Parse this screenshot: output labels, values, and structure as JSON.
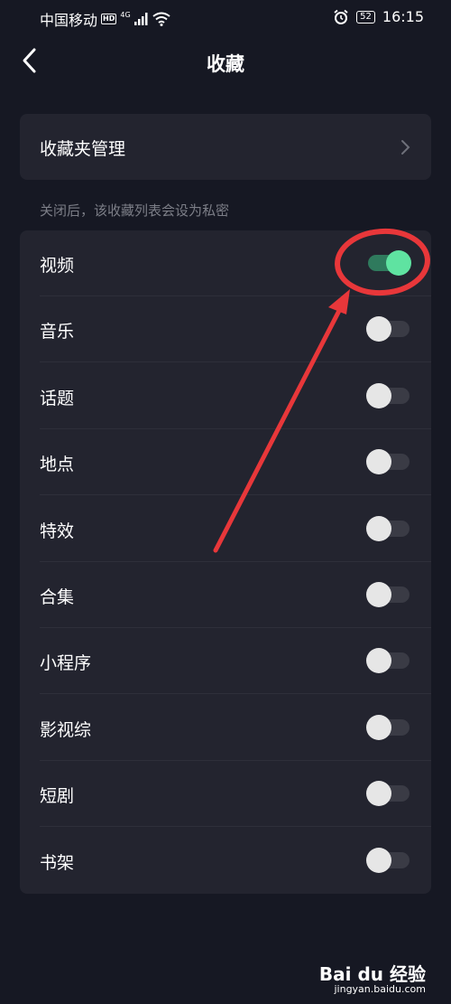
{
  "status_bar": {
    "carrier": "中国移动",
    "hd": "HD",
    "network": "4G",
    "battery": "52",
    "time": "16:15"
  },
  "header": {
    "title": "收藏"
  },
  "manage": {
    "label": "收藏夹管理"
  },
  "section_note": "关闭后，该收藏列表会设为私密",
  "toggles": [
    {
      "label": "视频",
      "on": true
    },
    {
      "label": "音乐",
      "on": false
    },
    {
      "label": "话题",
      "on": false
    },
    {
      "label": "地点",
      "on": false
    },
    {
      "label": "特效",
      "on": false
    },
    {
      "label": "合集",
      "on": false
    },
    {
      "label": "小程序",
      "on": false
    },
    {
      "label": "影视综",
      "on": false
    },
    {
      "label": "短剧",
      "on": false
    },
    {
      "label": "书架",
      "on": false
    }
  ],
  "colors": {
    "background": "#161823",
    "card": "#23242f",
    "toggle_on": "#5fe3a1",
    "annotation": "#e8373a"
  },
  "watermark": {
    "brand": "Bai du 经验",
    "url": "jingyan.baidu.com"
  }
}
